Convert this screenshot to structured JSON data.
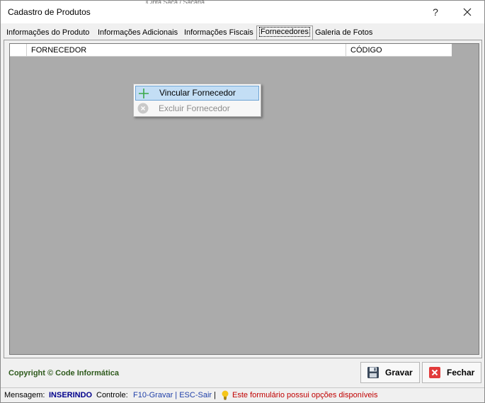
{
  "window": {
    "title": "Cadastro de Produtos",
    "help_label": "?",
    "background_text": "Cinta Saca / Sacaria"
  },
  "tabs": [
    {
      "label": "Informações do Produto",
      "active": false
    },
    {
      "label": "Informações Adicionais",
      "active": false
    },
    {
      "label": "Informações Fiscais",
      "active": false
    },
    {
      "label": "Fornecedores",
      "active": true
    },
    {
      "label": "Galeria de Fotos",
      "active": false
    }
  ],
  "grid": {
    "columns": [
      "FORNECEDOR",
      "CÓDIGO"
    ],
    "rows": []
  },
  "context_menu": {
    "items": [
      {
        "label": "Vincular Fornecedor",
        "icon": "plus-icon",
        "enabled": true,
        "highlighted": true
      },
      {
        "label": "Excluir Fornecedor",
        "icon": "delete-circle-icon",
        "enabled": false,
        "highlighted": false
      }
    ]
  },
  "footer": {
    "copyright": "Copyright © Code Informática",
    "save_label": "Gravar",
    "close_label": "Fechar"
  },
  "statusbar": {
    "message_label": "Mensagem:",
    "message_value": "INSERINDO",
    "control_label": "Controle:",
    "control_value": "F10-Gravar | ESC-Sair",
    "separator": "|",
    "hint": "Este formulário possui opções disponíveis"
  },
  "colors": {
    "grid_background": "#ababab",
    "menu_highlight": "#c3def5",
    "copyright": "#2e5a1c",
    "hint_text": "#c00000",
    "status_value": "#00008b"
  }
}
